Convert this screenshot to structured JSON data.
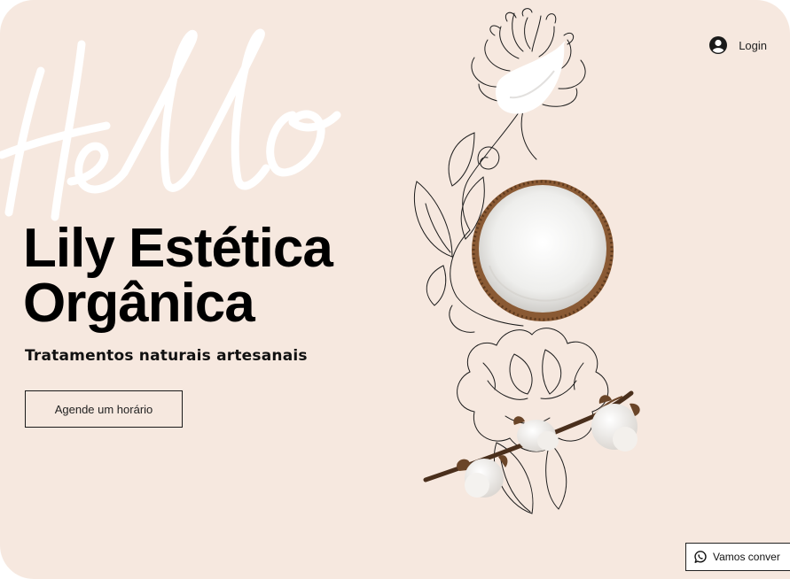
{
  "header": {
    "login_label": "Login",
    "login_icon": "user-avatar-icon"
  },
  "hero": {
    "script_word": "Hello",
    "title_line1": "Lily Estética",
    "title_line2": "Orgânica",
    "subtitle": "Tratamentos naturais artesanais",
    "cta_label": "Agende um horário"
  },
  "decor": {
    "illustration": "line-art flowers with cream swatch, half coconut and cotton bolls"
  },
  "chat": {
    "label": "Vamos conver",
    "icon": "whatsapp-icon"
  },
  "colors": {
    "background": "#f6e8df",
    "text": "#000000",
    "script_stroke": "#ffffff"
  }
}
